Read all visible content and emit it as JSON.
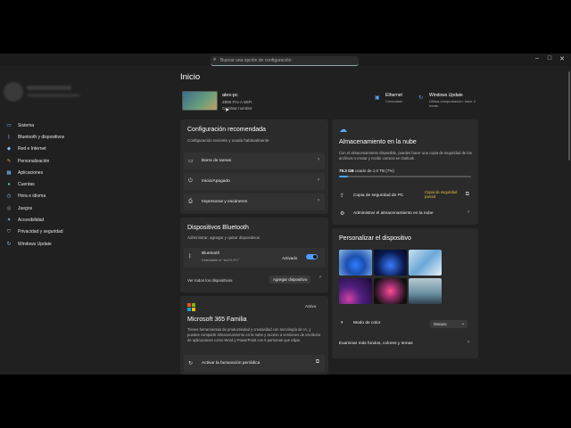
{
  "window": {
    "search_placeholder": "Buscar una opción de configuración",
    "minimize": "–",
    "maximize": "□",
    "close": "✕"
  },
  "sidebar": {
    "items": [
      {
        "label": "Sistema",
        "icon": "monitor-icon"
      },
      {
        "label": "Bluetooth y dispositivos",
        "icon": "bluetooth-icon"
      },
      {
        "label": "Red e Internet",
        "icon": "wifi-icon"
      },
      {
        "label": "Personalización",
        "icon": "brush-icon"
      },
      {
        "label": "Aplicaciones",
        "icon": "apps-icon"
      },
      {
        "label": "Cuentas",
        "icon": "person-icon"
      },
      {
        "label": "Hora e idioma",
        "icon": "clock-icon"
      },
      {
        "label": "Juegos",
        "icon": "gamepad-icon"
      },
      {
        "label": "Accesibilidad",
        "icon": "accessibility-icon"
      },
      {
        "label": "Privacidad y seguridad",
        "icon": "shield-icon"
      },
      {
        "label": "Windows Update",
        "icon": "update-icon"
      }
    ]
  },
  "header": {
    "title": "Inicio",
    "device_name": "alex-pc",
    "device_model": "Z890 Pro-A WIFI",
    "rename": "Cambiar nombre",
    "ethernet_title": "Ethernet",
    "ethernet_status": "Conectado",
    "update_title": "Windows Update",
    "update_status": "Última comprobación: hace 4 horas"
  },
  "recommended": {
    "title": "Configuración recomendada",
    "subtitle": "Configuración reciente y usada habitualmente",
    "items": [
      {
        "label": "Barra de tareas"
      },
      {
        "label": "Inicio/Apagado"
      },
      {
        "label": "Impresoras y escáneres"
      }
    ]
  },
  "bluetooth": {
    "title": "Dispositivos Bluetooth",
    "subtitle": "Administrar, agregar y quitar dispositivos",
    "item_label": "Bluetooth",
    "item_sub": "Detectable el \"ALEX-PC\"",
    "toggle_label": "Activado",
    "view_all": "Ver todos los dispositivos",
    "add_button": "Agregar dispositivo"
  },
  "m365": {
    "badge": "Activo",
    "title": "Microsoft 365 Familia",
    "desc": "Tienes herramientas de productividad y creatividad con tecnología de IA, y puedes compartir almacenamiento en la nube y acceso a versiones de escritorio de aplicaciones como Word y PowerPoint con 5 personas que elijas.",
    "link": "Activar la facturación periódica"
  },
  "cloud": {
    "title": "Almacenamiento en la nube",
    "desc": "Con el almacenamiento disponible, puedes hacer una copia de seguridad de los archivos o enviar y recibir correos en Outlook.",
    "usage_value": "79.3 GB",
    "usage_text": "usado de 1.0 TB (7%)",
    "usage_fraction": 0.07,
    "backup_label": "Copia de seguridad de PC",
    "backup_status": "Copia de seguridad parcial",
    "manage_label": "Administrar el almacenamiento en la nube"
  },
  "personalize": {
    "title": "Personalizar el dispositivo",
    "color_mode_label": "Modo de color",
    "color_mode_value": "Oscuro",
    "more_label": "Examinar más fondos, colores y temas"
  },
  "colors": {
    "accent": "#4aa0ff",
    "warning": "#e0c040"
  }
}
